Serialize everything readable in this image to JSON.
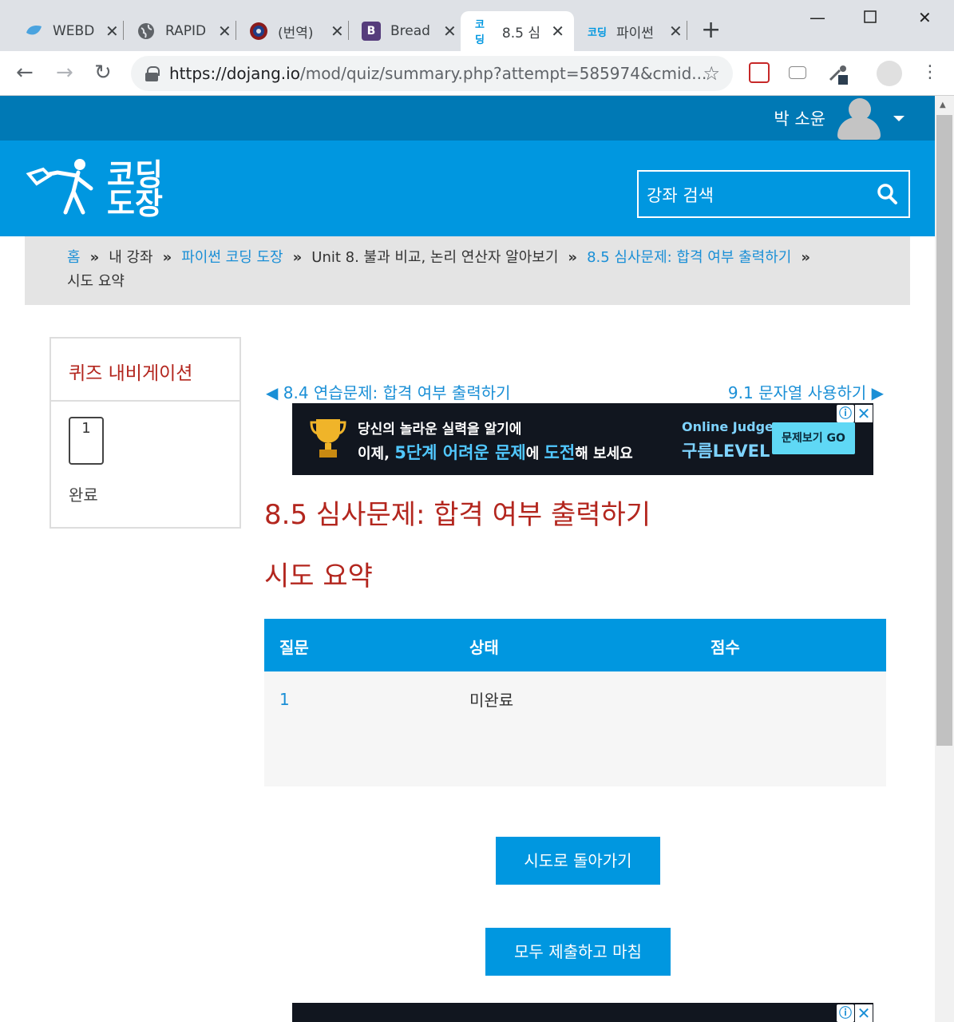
{
  "browser": {
    "tabs": [
      {
        "title": "WEBD",
        "favicon": "leaf-icon",
        "active": false
      },
      {
        "title": "RAPID",
        "favicon": "globe-icon",
        "active": false
      },
      {
        "title": "(번역)",
        "favicon": "shield-icon",
        "active": false
      },
      {
        "title": "Bread",
        "favicon": "B",
        "active": false
      },
      {
        "title": "8.5 심",
        "favicon": "코딩",
        "active": true
      },
      {
        "title": "파이썬",
        "favicon": "코딩",
        "active": false
      }
    ],
    "url_host": "https://dojang.io",
    "url_path": "/mod/quiz/summary.php?attempt=585974&cmid..."
  },
  "site": {
    "username": "박 소윤",
    "logo_line1": "코딩",
    "logo_line2": "도장",
    "search_placeholder": "강좌 검색",
    "colors": {
      "topbar": "#0079b5",
      "header": "#0097e0",
      "accent": "#b3261e",
      "link": "#1a8fd6"
    }
  },
  "breadcrumb": {
    "home": "홈",
    "my_courses": "내 강좌",
    "course": "파이썬 코딩 도장",
    "unit": "Unit 8. 불과 비교, 논리 연산자 알아보기",
    "quiz": "8.5 심사문제: 합격 여부 출력하기",
    "current": "시도 요약"
  },
  "quiz_nav": {
    "title": "퀴즈 내비게이션",
    "question_number": "1",
    "finished_label": "완료"
  },
  "nav_links": {
    "prev": "8.4 연습문제: 합격 여부 출력하기",
    "next": "9.1 문자열 사용하기"
  },
  "ad": {
    "line1": "당신의 놀라운 실력을 알기에",
    "line2_a": "이제, ",
    "line2_b": "5단계 어려운 문제",
    "line2_c": "에 ",
    "line2_d": "도전",
    "line2_e": "해 보세요",
    "brand1": "Online Judge",
    "brand2": "구름LEVEL",
    "cta": "문제보기 GO"
  },
  "main": {
    "title": "8.5 심사문제: 합격 여부 출력하기",
    "subtitle": "시도 요약"
  },
  "summary_table": {
    "headers": [
      "질문",
      "상태",
      "점수"
    ],
    "rows": [
      {
        "question": "1",
        "status": "미완료",
        "score": ""
      }
    ]
  },
  "buttons": {
    "return": "시도로 돌아가기",
    "submit": "모두 제출하고 마침"
  }
}
